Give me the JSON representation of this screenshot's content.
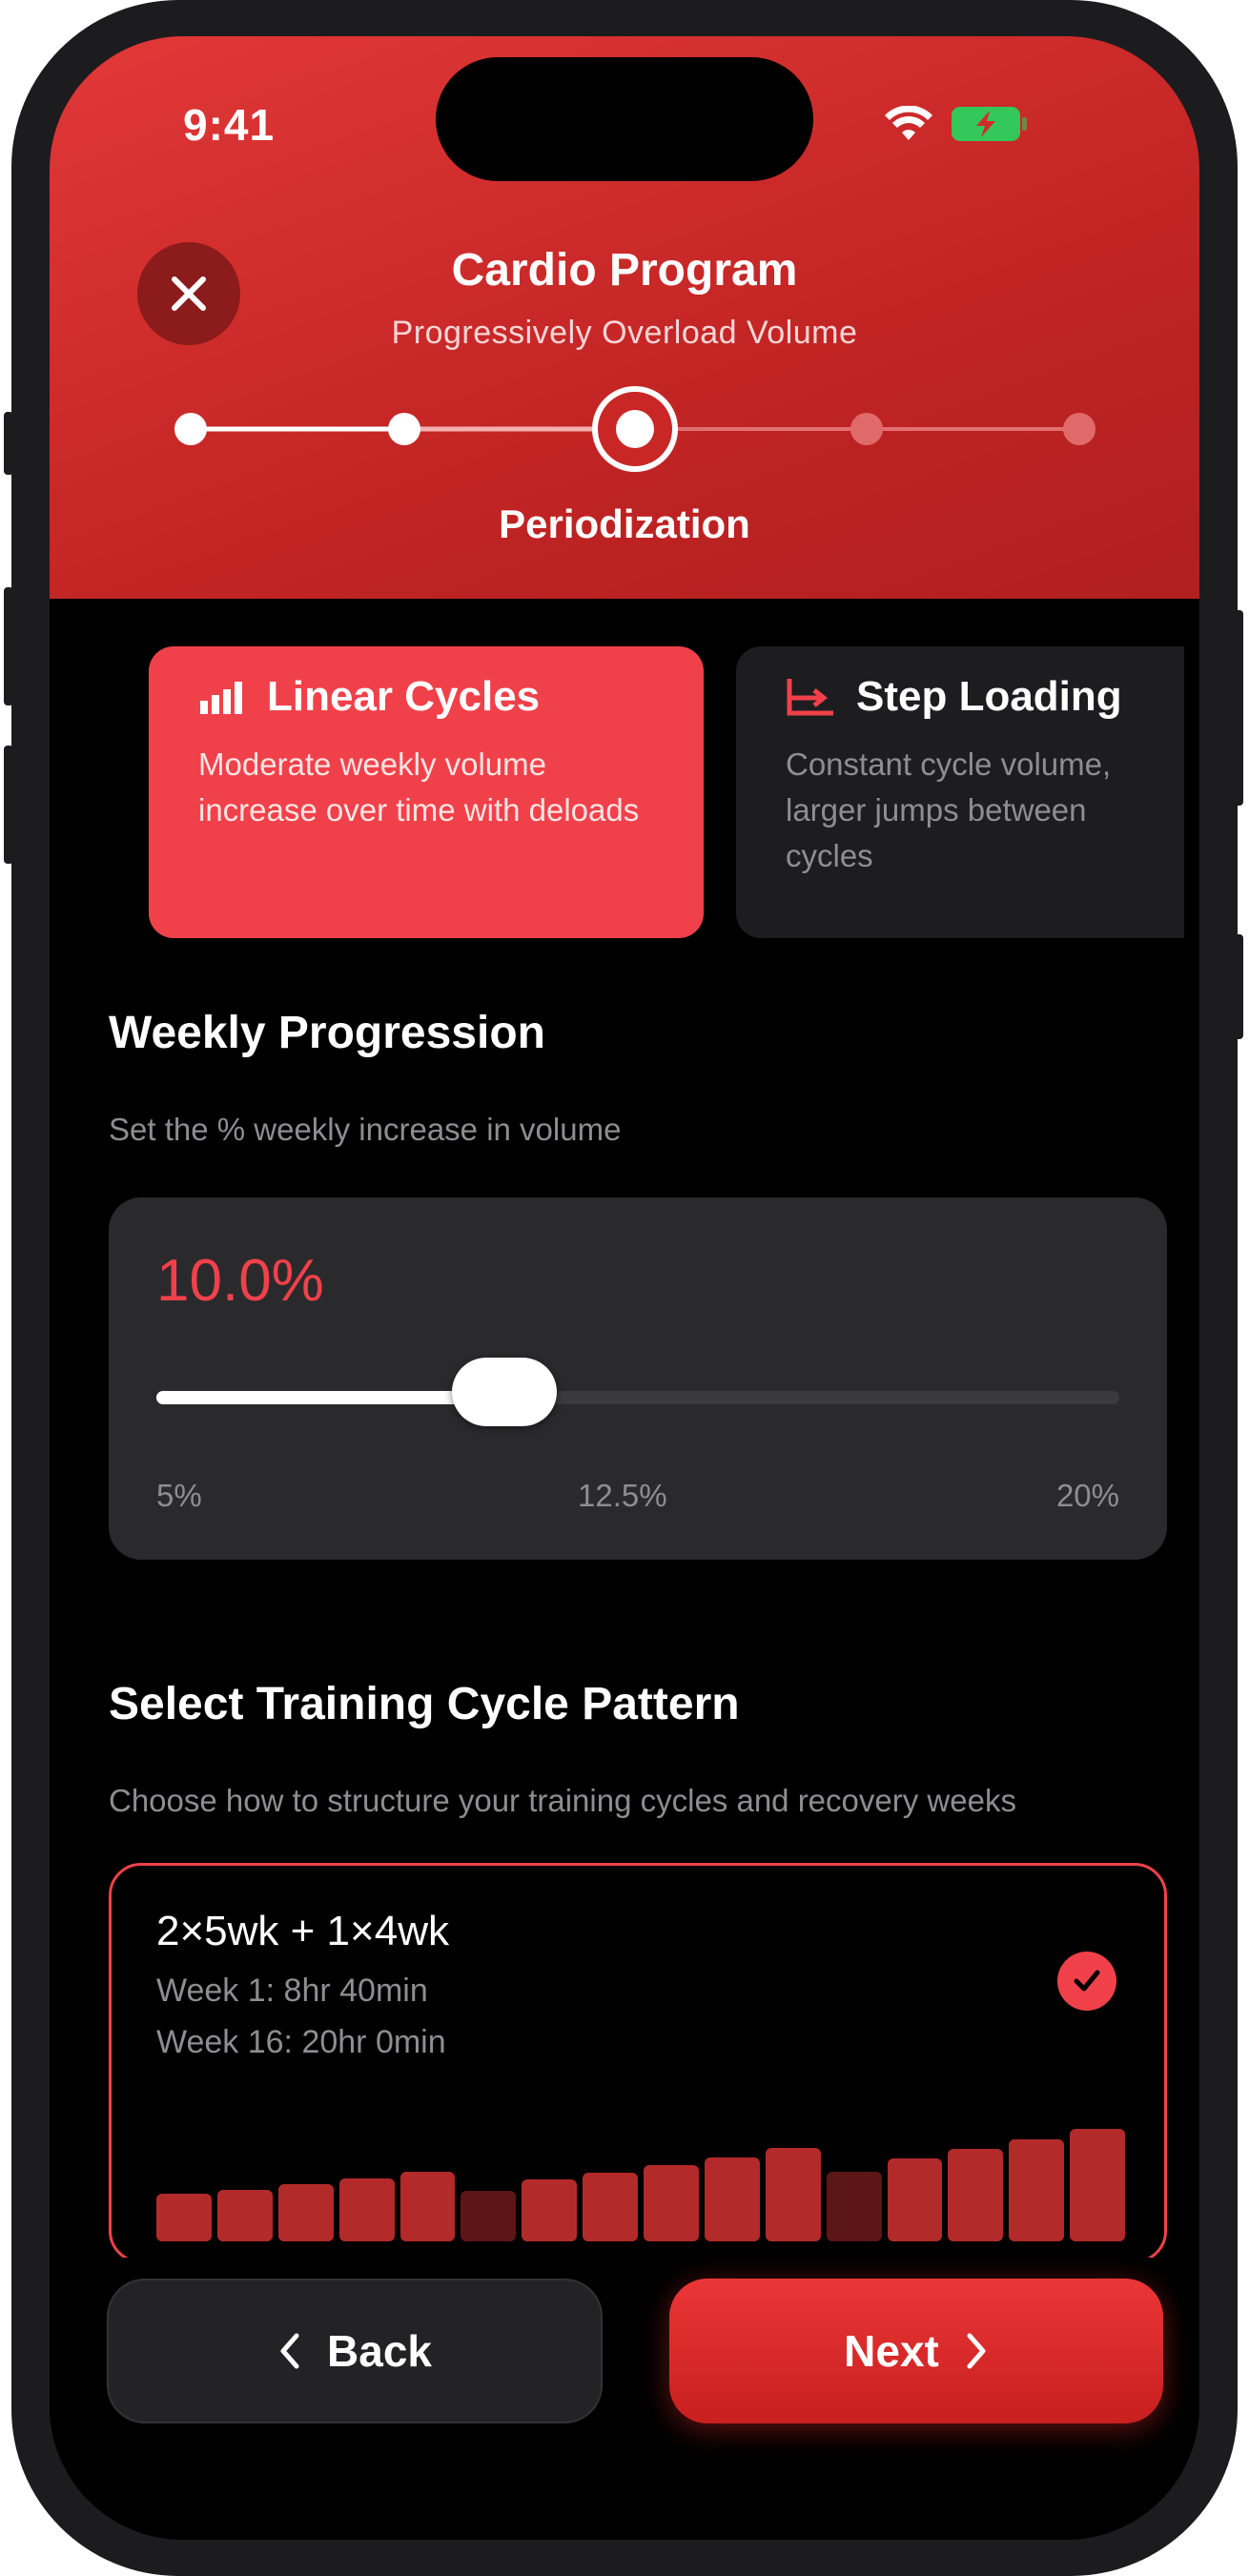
{
  "status_bar": {
    "time": "9:41",
    "wifi_icon": "wifi-icon",
    "battery_icon": "battery-charging-icon",
    "battery_color": "#34c759"
  },
  "header": {
    "title": "Cardio Program",
    "subtitle": "Progressively Overload Volume",
    "close_icon": "close-icon",
    "current_step_label": "Periodization",
    "total_steps": 5,
    "current_step": 3,
    "accent_color": "#d12a2a"
  },
  "progression_types": [
    {
      "title": "Linear Cycles",
      "description": "Moderate weekly volume increase over time with deloads",
      "icon": "bar-chart-icon",
      "selected": true
    },
    {
      "title": "Step Loading",
      "description": "Constant cycle volume, larger jumps between cycles",
      "icon": "step-chart-icon",
      "selected": false
    }
  ],
  "weekly_progression": {
    "title": "Weekly Progression",
    "subtitle": "Set the % weekly increase in volume",
    "value_label": "10.0%",
    "value": 10.0,
    "min_label": "5%",
    "mid_label": "12.5%",
    "max_label": "20%",
    "min": 5,
    "max": 20
  },
  "cycle_pattern": {
    "title": "Select Training Cycle Pattern",
    "subtitle": "Choose how to structure your training cycles and recovery weeks",
    "options": [
      {
        "name": "2×5wk + 1×4wk",
        "week_first": "Week 1: 8hr 40min",
        "week_last": "Week 16: 20hr 0min",
        "selected": true,
        "check_icon": "checkmark-icon",
        "weekly_volume_bars": [
          0.42,
          0.46,
          0.51,
          0.56,
          0.62,
          0.45,
          0.55,
          0.61,
          0.68,
          0.75,
          0.83,
          0.62,
          0.74,
          0.82,
          0.91,
          1.0
        ],
        "deload_weeks": [
          6,
          12
        ],
        "bar_color": "#b32a2a",
        "deload_bar_color": "#5c1616"
      }
    ]
  },
  "footer": {
    "back_label": "Back",
    "back_icon": "chevron-left-icon",
    "next_label": "Next",
    "next_icon": "chevron-right-icon"
  }
}
